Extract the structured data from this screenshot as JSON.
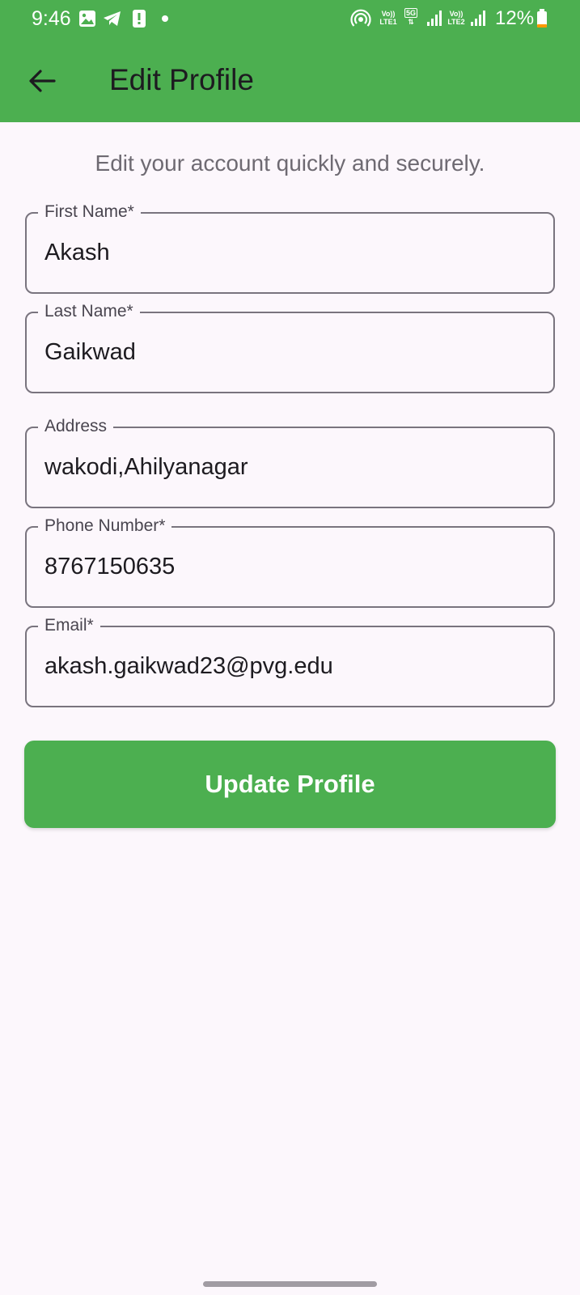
{
  "status_bar": {
    "time": "9:46",
    "icons": [
      "gallery-icon",
      "telegram-icon",
      "alert-icon",
      "notification-dot",
      "hotspot-icon",
      "volte-1-icon",
      "5g-icon",
      "signal-1-icon",
      "volte-2-icon",
      "signal-2-icon",
      "battery-icon"
    ],
    "volte1_top": "Vo))",
    "volte1_bottom": "LTE1",
    "net_5g": "5G",
    "volte2_top": "Vo))",
    "volte2_bottom": "LTE2",
    "battery_percent": "12%"
  },
  "app_bar": {
    "title": "Edit Profile",
    "back_icon": "arrow-back-icon",
    "color": "#4caf50"
  },
  "subtitle": "Edit your account quickly and securely.",
  "form": {
    "first_name": {
      "label": "First Name*",
      "value": "Akash"
    },
    "last_name": {
      "label": "Last Name*",
      "value": "Gaikwad"
    },
    "address": {
      "label": "Address",
      "value": "wakodi,Ahilyanagar"
    },
    "phone": {
      "label": "Phone Number*",
      "value": "8767150635"
    },
    "email": {
      "label": "Email*",
      "value": "akash.gaikwad23@pvg.edu"
    }
  },
  "update_button": {
    "label": "Update Profile",
    "color": "#4caf50"
  }
}
